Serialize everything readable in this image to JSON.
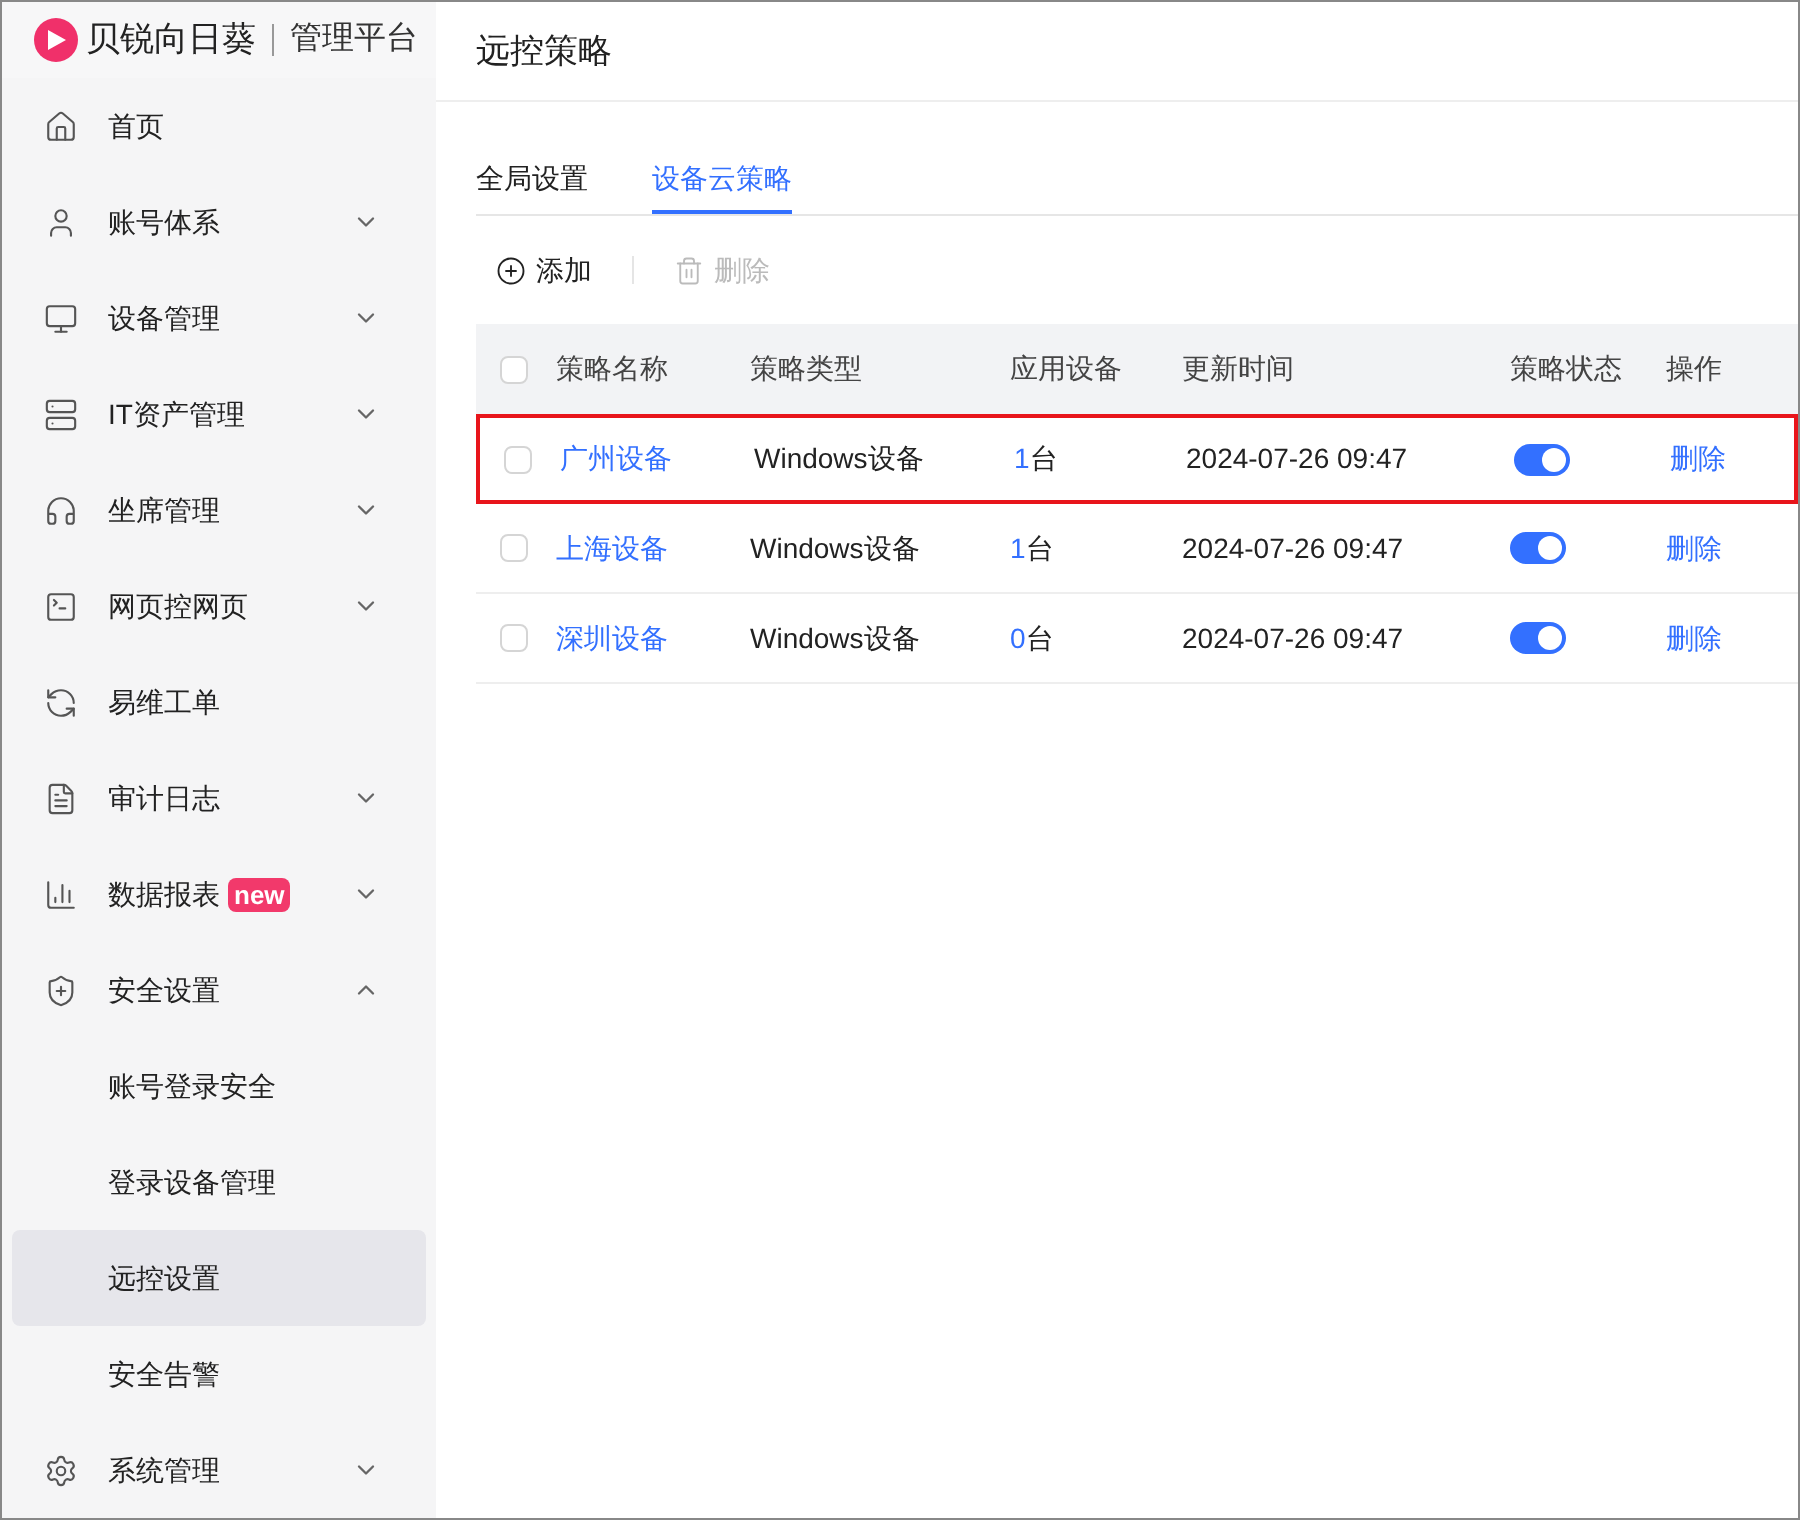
{
  "brand": {
    "name": "贝锐向日葵",
    "product": "管理平台"
  },
  "sidebar": {
    "items": [
      {
        "label": "首页",
        "expandable": false
      },
      {
        "label": "账号体系",
        "expandable": true,
        "expanded": false
      },
      {
        "label": "设备管理",
        "expandable": true,
        "expanded": false
      },
      {
        "label": "IT资产管理",
        "expandable": true,
        "expanded": false
      },
      {
        "label": "坐席管理",
        "expandable": true,
        "expanded": false
      },
      {
        "label": "网页控网页",
        "expandable": true,
        "expanded": false
      },
      {
        "label": "易维工单",
        "expandable": false
      },
      {
        "label": "审计日志",
        "expandable": true,
        "expanded": false
      },
      {
        "label": "数据报表",
        "badge": "new",
        "expandable": true,
        "expanded": false
      },
      {
        "label": "安全设置",
        "expandable": true,
        "expanded": true,
        "children": [
          {
            "label": "账号登录安全",
            "selected": false
          },
          {
            "label": "登录设备管理",
            "selected": false
          },
          {
            "label": "远控设置",
            "selected": true
          },
          {
            "label": "安全告警",
            "selected": false
          }
        ]
      },
      {
        "label": "系统管理",
        "expandable": true,
        "expanded": false
      }
    ]
  },
  "page_title": "远控策略",
  "tabs": [
    {
      "label": "全局设置",
      "selected": false
    },
    {
      "label": "设备云策略",
      "selected": true
    }
  ],
  "toolbar": [
    {
      "label": "添加",
      "disabled": false
    },
    {
      "label": "删除",
      "disabled": true
    }
  ],
  "table": {
    "all_checked": false,
    "columns": [
      "策略名称",
      "策略类型",
      "应用设备",
      "更新时间",
      "策略状态",
      "操作"
    ],
    "rows": [
      {
        "checked": false,
        "name": "广州设备",
        "type": "Windows设备",
        "count": "1",
        "unit": "台",
        "updated": "2024-07-26 09:47",
        "on": true,
        "action": "删除",
        "highlighted": true
      },
      {
        "checked": false,
        "name": "上海设备",
        "type": "Windows设备",
        "count": "1",
        "unit": "台",
        "updated": "2024-07-26 09:47",
        "on": true,
        "action": "删除",
        "highlighted": false
      },
      {
        "checked": false,
        "name": "深圳设备",
        "type": "Windows设备",
        "count": "0",
        "unit": "台",
        "updated": "2024-07-26 09:47",
        "on": true,
        "action": "删除",
        "highlighted": false
      }
    ]
  }
}
